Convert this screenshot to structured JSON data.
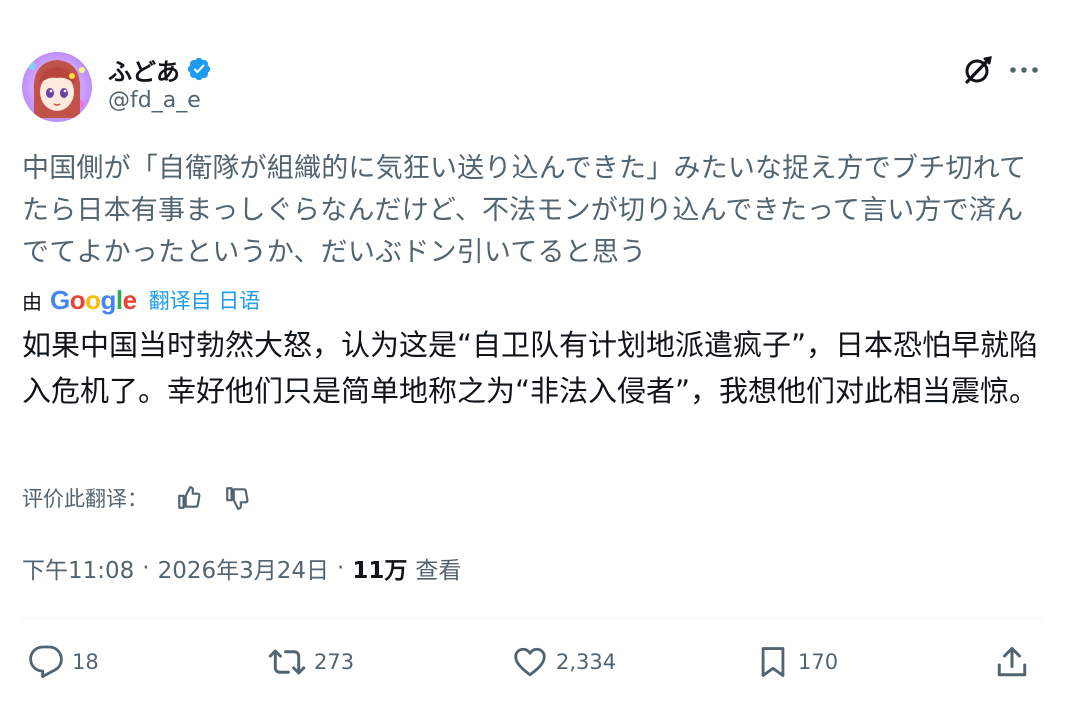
{
  "author": {
    "display_name": "ふどあ",
    "handle": "@fd_a_e",
    "verified": true
  },
  "tweet": {
    "original_text": "中国側が「自衛隊が組織的に気狂い送り込んできた」みたいな捉え方でブチ切れてたら日本有事まっしぐらなんだけど、不法モンが切り込んできたって言い方で済んでてよかったというか、だいぶドン引いてると思う",
    "translation_by_label": "由",
    "translation_provider": "Google",
    "translated_from_label": "翻译自 日语",
    "translated_text": "如果中国当时勃然大怒，认为这是“自卫队有计划地派遣疯子”，日本恐怕早就陷入危机了。幸好他们只是简单地称之为“非法入侵者”，我想他们对此相当震惊。",
    "rate_translation_label": "评价此翻译："
  },
  "meta": {
    "time": "下午11:08",
    "separator": "·",
    "date": "2026年3月24日",
    "views_count": "11万",
    "views_label": "查看"
  },
  "actions": {
    "replies": "18",
    "retweets": "273",
    "likes": "2,334",
    "bookmarks": "170"
  },
  "icons": {
    "verified": "verified-badge-icon",
    "grok": "grok-icon",
    "more": "more-dots-icon",
    "thumbs_up": "thumbs-up-icon",
    "thumbs_down": "thumbs-down-icon",
    "reply": "reply-bubble-icon",
    "retweet": "retweet-icon",
    "like": "heart-icon",
    "bookmark": "bookmark-icon",
    "share": "share-upload-icon"
  },
  "colors": {
    "accent_blue": "#1d9bf0",
    "text_primary": "#0f1419",
    "text_secondary": "#536471"
  }
}
